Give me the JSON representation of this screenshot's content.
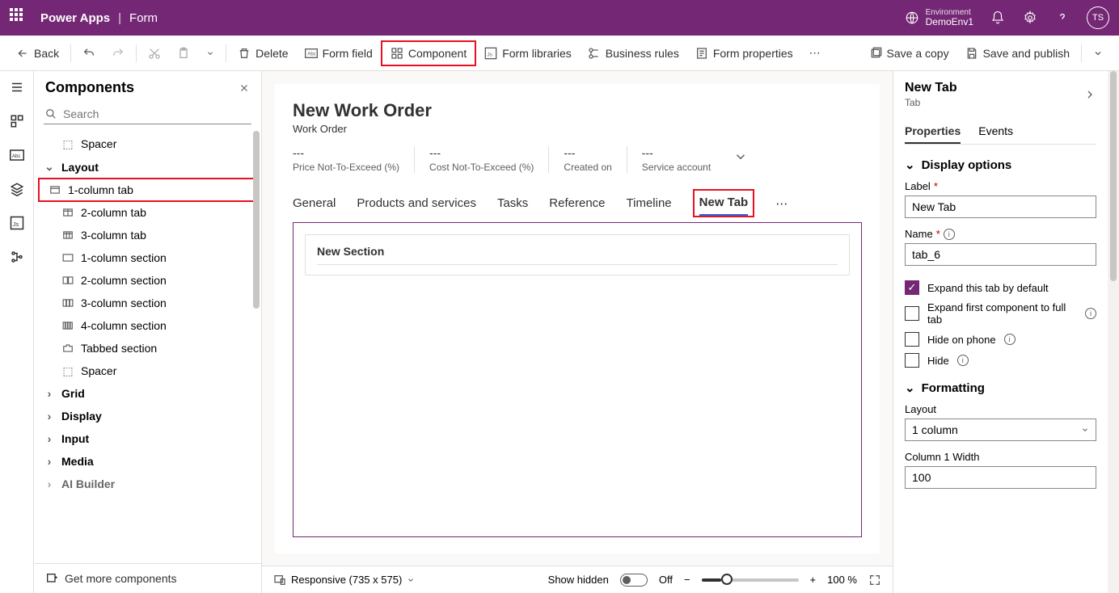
{
  "header": {
    "app": "Power Apps",
    "page": "Form",
    "env_label": "Environment",
    "env_name": "DemoEnv1",
    "avatar": "TS"
  },
  "cmd": {
    "back": "Back",
    "delete": "Delete",
    "form_field": "Form field",
    "component": "Component",
    "form_libraries": "Form libraries",
    "business_rules": "Business rules",
    "form_properties": "Form properties",
    "save_copy": "Save a copy",
    "save_publish": "Save and publish"
  },
  "left": {
    "title": "Components",
    "search_ph": "Search",
    "items": {
      "spacer1": "Spacer",
      "layout": "Layout",
      "col1tab": "1-column tab",
      "col2tab": "2-column tab",
      "col3tab": "3-column tab",
      "sec1": "1-column section",
      "sec2": "2-column section",
      "sec3": "3-column section",
      "sec4": "4-column section",
      "tabbed": "Tabbed section",
      "spacer2": "Spacer",
      "grid": "Grid",
      "display": "Display",
      "input": "Input",
      "media": "Media",
      "ai": "AI Builder"
    },
    "footer": "Get more components"
  },
  "form": {
    "title": "New Work Order",
    "entity": "Work Order",
    "kpi": {
      "price": {
        "val": "---",
        "lbl": "Price Not-To-Exceed (%)"
      },
      "cost": {
        "val": "---",
        "lbl": "Cost Not-To-Exceed (%)"
      },
      "created": {
        "val": "---",
        "lbl": "Created on"
      },
      "service": {
        "val": "---",
        "lbl": "Service account"
      }
    },
    "tabs": {
      "general": "General",
      "products": "Products and services",
      "tasks": "Tasks",
      "reference": "Reference",
      "timeline": "Timeline",
      "newtab": "New Tab"
    },
    "section": "New Section"
  },
  "status": {
    "responsive": "Responsive (735 x 575)",
    "showhidden": "Show hidden",
    "off": "Off",
    "zoom": "100 %"
  },
  "right": {
    "title": "New Tab",
    "sub": "Tab",
    "tabs": {
      "properties": "Properties",
      "events": "Events"
    },
    "display_options": "Display options",
    "label_lbl": "Label",
    "label_val": "New Tab",
    "name_lbl": "Name",
    "name_val": "tab_6",
    "expand_default": "Expand this tab by default",
    "expand_first": "Expand first component to full tab",
    "hide_phone": "Hide on phone",
    "hide": "Hide",
    "formatting": "Formatting",
    "layout_lbl": "Layout",
    "layout_val": "1 column",
    "col1w_lbl": "Column 1 Width",
    "col1w_val": "100"
  }
}
